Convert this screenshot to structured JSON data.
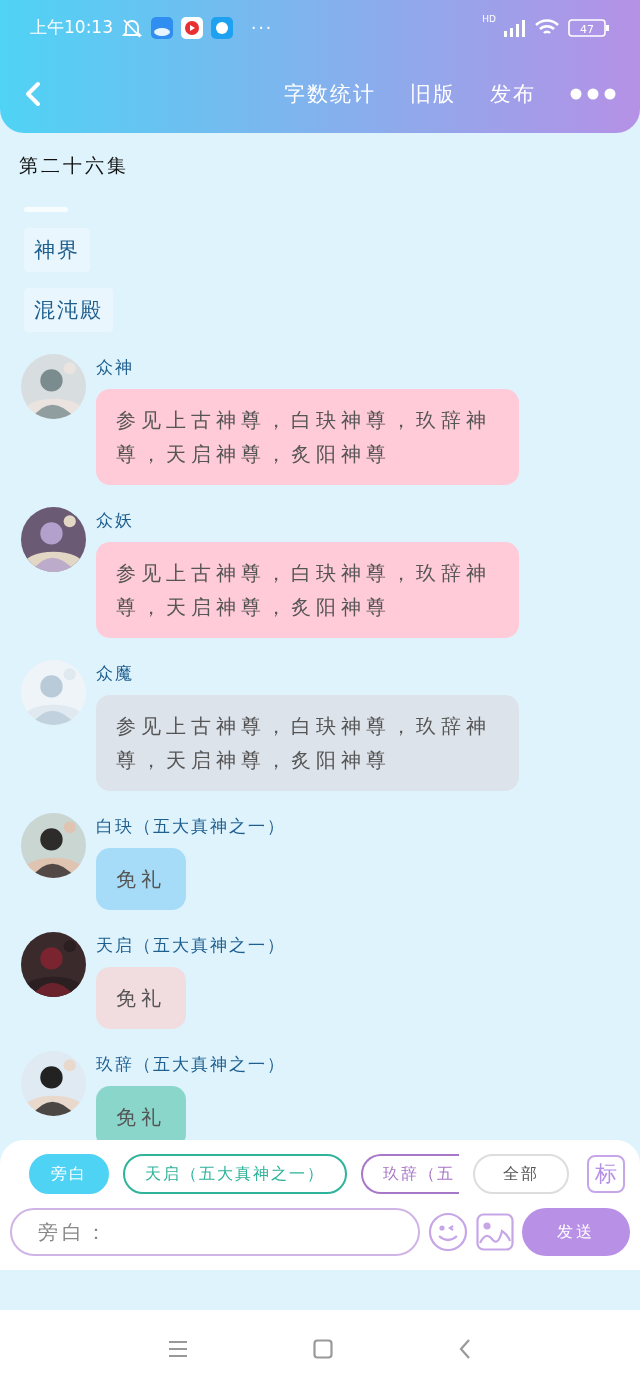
{
  "status_bar": {
    "time": "上午10:13",
    "more": "···",
    "network": "HD",
    "battery": "47"
  },
  "header": {
    "actions": [
      "字数统计",
      "旧版",
      "发布"
    ]
  },
  "episode": {
    "title": "第二十六集"
  },
  "scenes": [
    "神界",
    "混沌殿"
  ],
  "messages": [
    {
      "name": "众神",
      "text": "参见上古神尊，白玦神尊，玖辞神尊，天启神尊，炙阳神尊",
      "color": "#ffcbd8"
    },
    {
      "name": "众妖",
      "text": "参见上古神尊，白玦神尊，玖辞神尊，天启神尊，炙阳神尊",
      "color": "#ffcbd8"
    },
    {
      "name": "众魔",
      "text": "参见上古神尊，白玦神尊，玖辞神尊，天启神尊，炙阳神尊",
      "color": "#dde3ea"
    },
    {
      "name": "白玦（五大真神之一）",
      "text": "免礼",
      "color": "#a6dcf7"
    },
    {
      "name": "天启（五大真神之一）",
      "text": "免礼",
      "color": "#f1dde0"
    },
    {
      "name": "玖辞（五大真神之一）",
      "text": "免礼",
      "color": "#8ad6ca"
    }
  ],
  "composer": {
    "roles": [
      {
        "label": "旁白",
        "selected": true,
        "color": "#4fd3f5"
      },
      {
        "label": "天启（五大真神之一）",
        "selected": false,
        "color": "#2fb39b"
      },
      {
        "label": "玖辞（五",
        "selected": false,
        "color": "#a777c8"
      },
      {
        "label": "全部",
        "selected": false,
        "color": "#dddddd"
      }
    ],
    "mark_button": "标",
    "input": {
      "placeholder": "旁白："
    },
    "send": "发送"
  }
}
